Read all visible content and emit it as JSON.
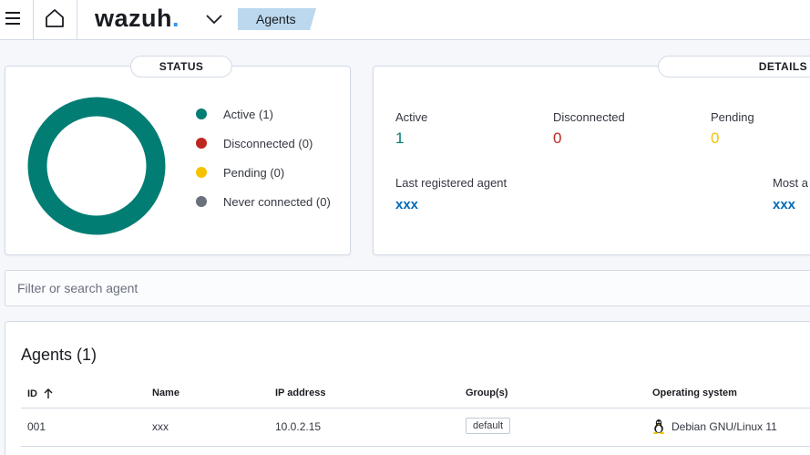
{
  "header": {
    "logo_text": "wazuh",
    "logo_dot": ".",
    "breadcrumb": "Agents"
  },
  "status": {
    "title": "STATUS",
    "legend": [
      {
        "label": "Active (1)",
        "color": "#017d73"
      },
      {
        "label": "Disconnected (0)",
        "color": "#bd271e"
      },
      {
        "label": "Pending (0)",
        "color": "#f5c200"
      },
      {
        "label": "Never connected (0)",
        "color": "#6a717d"
      }
    ],
    "donut_color": "#017d73"
  },
  "details": {
    "title": "DETAILS",
    "active_label": "Active",
    "active_value": "1",
    "disconnected_label": "Disconnected",
    "disconnected_value": "0",
    "pending_label": "Pending",
    "pending_value": "0",
    "last_registered_label": "Last registered agent",
    "last_registered_value": "xxx",
    "most_active_label": "Most a",
    "most_active_value": "xxx"
  },
  "search": {
    "placeholder": "Filter or search agent"
  },
  "table": {
    "title": "Agents (1)",
    "columns": [
      "ID",
      "Name",
      "IP address",
      "Group(s)",
      "Operating system"
    ],
    "rows": [
      {
        "id": "001",
        "name": "xxx",
        "ip": "10.0.2.15",
        "group": "default",
        "os": "Debian GNU/Linux 11"
      }
    ]
  }
}
